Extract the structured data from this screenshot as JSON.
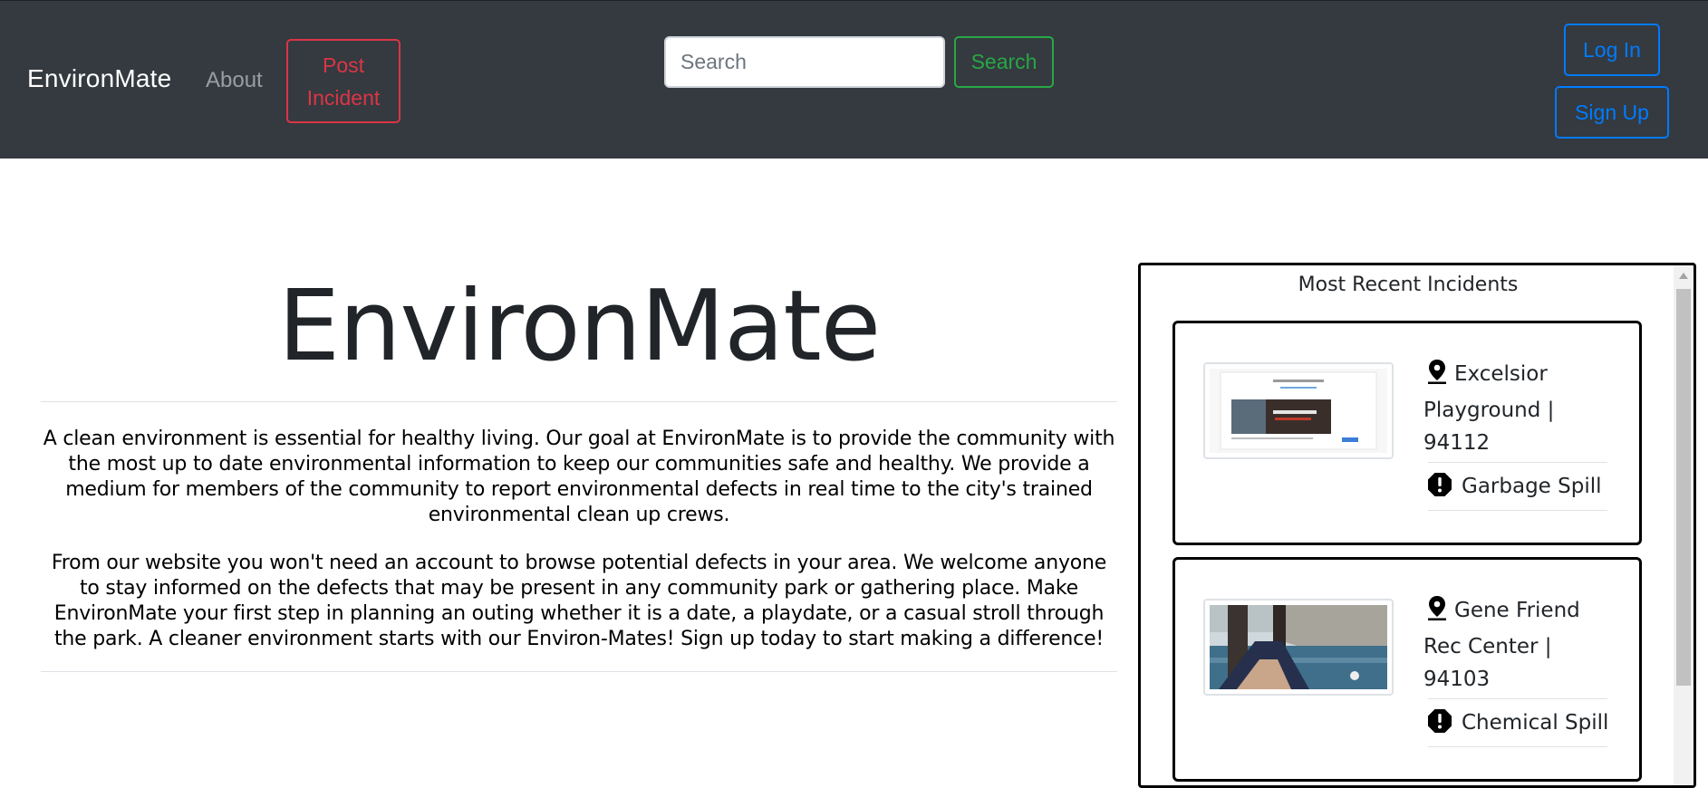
{
  "nav": {
    "brand": "EnvironMate",
    "about": "About",
    "post_incident": "Post Incident",
    "search_placeholder": "Search",
    "search_button": "Search",
    "login": "Log In",
    "signup": "Sign Up"
  },
  "hero": {
    "title": "EnvironMate",
    "paragraph1": "A clean environment is essential for healthy living. Our goal at EnvironMate is to provide the community with the most up to date environmental information to keep our communities safe and healthy. We provide a medium for members of the community to report environmental defects in real time to the city's trained environmental clean up crews.",
    "paragraph2": "From our website you won't need an account to browse potential defects in your area. We welcome anyone to stay informed on the defects that may be present in any community park or gathering place. Make EnvironMate your first step in planning an outing whether it is a date, a playdate, or a casual stroll through the park. A cleaner environment starts with our Environ-Mates! Sign up today to start making a difference!"
  },
  "recent": {
    "title": "Most Recent Incidents",
    "incidents": [
      {
        "location": "Excelsior Playground | 94112",
        "type": "Garbage Spill",
        "icon_location": "map-pin-icon",
        "icon_type": "alert-octagon-icon"
      },
      {
        "location": "Gene Friend Rec Center | 94103",
        "type": "Chemical Spill",
        "icon_location": "map-pin-icon",
        "icon_type": "alert-octagon-icon"
      }
    ]
  },
  "colors": {
    "navbar": "#343a40",
    "danger": "#dc3545",
    "success": "#28a745",
    "primary": "#007bff"
  }
}
